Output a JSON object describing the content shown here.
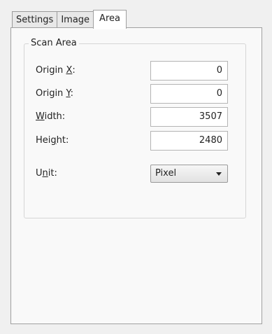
{
  "tabs": [
    {
      "label": "Settings",
      "active": false
    },
    {
      "label": "Image",
      "active": false
    },
    {
      "label": "Area",
      "active": true
    }
  ],
  "scan_area": {
    "title": "Scan Area",
    "origin_x": {
      "label_pre": "Origin ",
      "label_key": "X",
      "label_post": ":",
      "value": "0"
    },
    "origin_y": {
      "label_pre": "Origin ",
      "label_key": "Y",
      "label_post": ":",
      "value": "0"
    },
    "width": {
      "label_pre": "",
      "label_key": "W",
      "label_post": "idth:",
      "value": "3507"
    },
    "height": {
      "label_pre": "Hei",
      "label_key": "g",
      "label_post": "ht:",
      "value": "2480"
    },
    "unit": {
      "label_pre": "U",
      "label_key": "n",
      "label_post": "it:",
      "selected": "Pixel"
    }
  }
}
